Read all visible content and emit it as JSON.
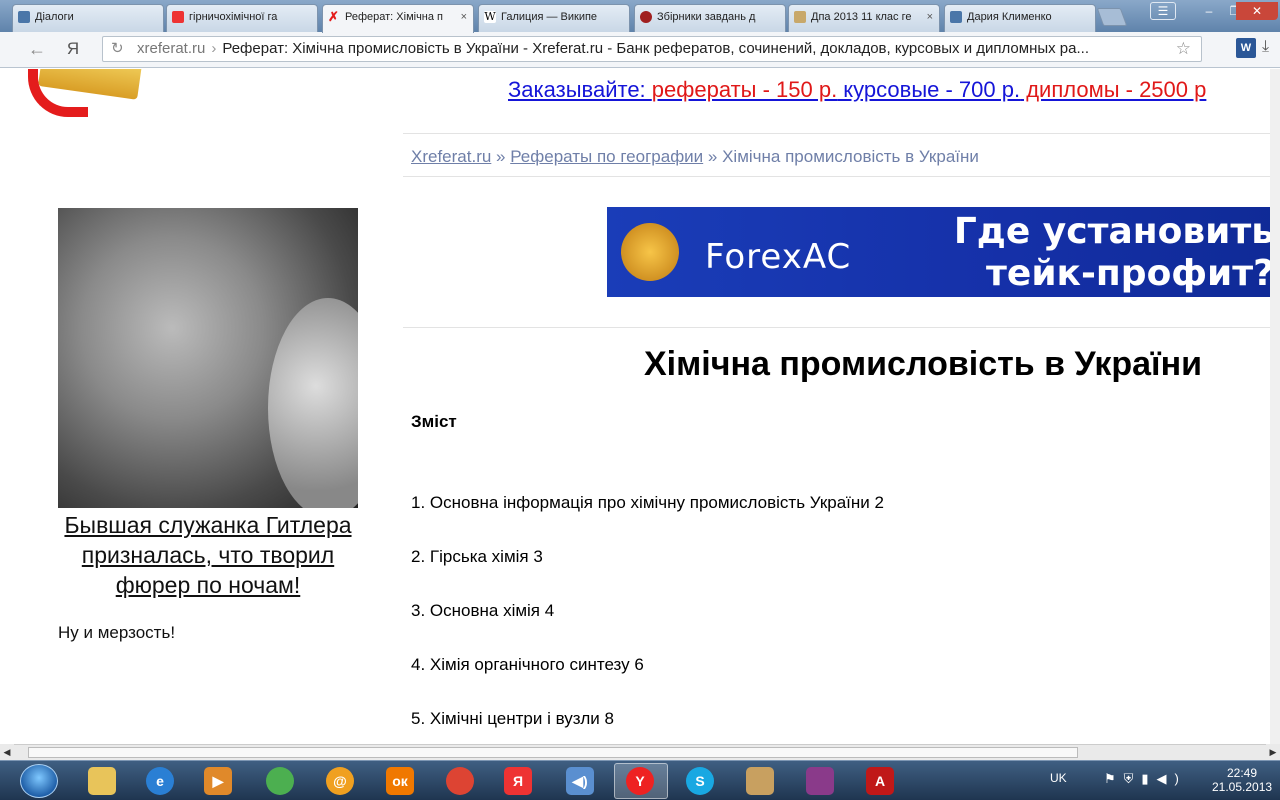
{
  "browser": {
    "tabs": [
      {
        "label": "Діалоги",
        "favicon_color": "#4a76a8"
      },
      {
        "label": "гірничохімічної га",
        "favicon_color": "#e33"
      },
      {
        "label": "Реферат: Хімічна п",
        "favicon_color": "#e41c1c",
        "active": true
      },
      {
        "label": "Галиция — Википе",
        "favicon_color": "#ffffff"
      },
      {
        "label": "Збірники завдань д",
        "favicon_color": "#a02020"
      },
      {
        "label": "Дпа 2013 11 клас ге",
        "favicon_color": "#c8a86a"
      },
      {
        "label": "Дария Клименко",
        "favicon_color": "#4a76a8"
      }
    ],
    "close_glyph": "×",
    "omnibox": {
      "host": "xreferat.ru",
      "separator": "›",
      "title": "Реферат: Хімічна промисловість в України - Xreferat.ru - Банк рефератов, сочинений, докладов, курсовых и дипломных ра..."
    },
    "back_glyph": "←",
    "yandex_glyph": "Я",
    "reload_glyph": "↻",
    "star_glyph": "☆"
  },
  "page": {
    "promo": {
      "prefix": "Заказывайте: ",
      "essays": "рефераты - 150 р.",
      "courses": " курсовые - 700 р.",
      "diplomas": " дипломы - 2500 р"
    },
    "breadcrumbs": {
      "home": "Xreferat.ru",
      "sep": " » ",
      "section": "Рефераты по географии",
      "current": "Хімічна промисловість в України"
    },
    "side_ad": {
      "caption": "Бывшая служанка Гитлера призналась, что творил фюрер по ночам!",
      "note": "Ну и мерзость!"
    },
    "banner": {
      "brand": "ForexAC",
      "slogan_line1": "Где установить",
      "slogan_line2": "тейк-профит?"
    },
    "title": "Хімічна промисловість в України",
    "toc_heading": "Зміст",
    "toc": [
      "1. Основна інформація про хімічну промисловість України 2",
      "2. Гірська хімія 3",
      "3. Основна хімія 4",
      "4. Хімія органічного синтезу 6",
      "5. Хімічні центри і вузли 8"
    ]
  },
  "taskbar": {
    "language": "UK",
    "time": "22:49",
    "date": "21.05.2013",
    "pinned": [
      "explorer",
      "internet-explorer",
      "media-player",
      "music-app",
      "mail-agent",
      "odnoklassniki",
      "chrome",
      "yandex",
      "speakers",
      "yandex-browser",
      "skype",
      "paint",
      "winrar",
      "acrobat"
    ]
  }
}
